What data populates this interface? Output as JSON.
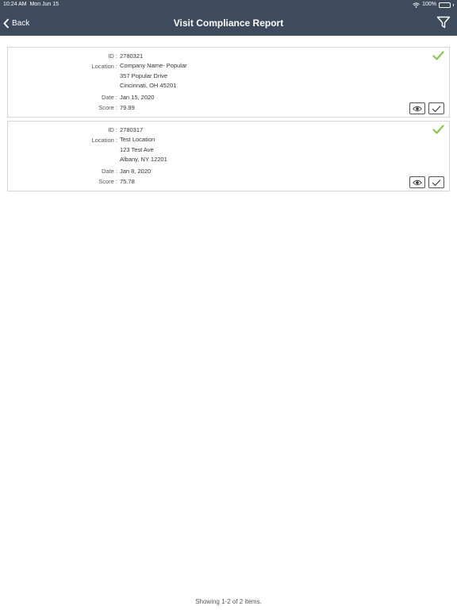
{
  "status_bar": {
    "time": "10:24 AM",
    "date": "Mon Jun 15",
    "battery": "100%"
  },
  "header": {
    "back_label": "Back",
    "title": "Visit Compliance Report"
  },
  "labels": {
    "id": "ID :",
    "location": "Location :",
    "date": "Date :",
    "score": "Score :"
  },
  "reports": [
    {
      "id": "2780321",
      "location_lines": [
        "Company Name- Popular",
        "357 Popular Drive",
        "Cincinnati, OH 45201"
      ],
      "date": "Jan 15, 2020",
      "score": "79.99",
      "status": "complete"
    },
    {
      "id": "2780317",
      "location_lines": [
        "Test Location",
        "123 Test Ave",
        "Albany, NY 12201"
      ],
      "date": "Jan 8, 2020",
      "score": "75.78",
      "status": "complete"
    }
  ],
  "footer": {
    "summary": "Showing 1-2 of 2 items."
  },
  "colors": {
    "header": "#3d4b5c",
    "check": "#8bc34a"
  }
}
